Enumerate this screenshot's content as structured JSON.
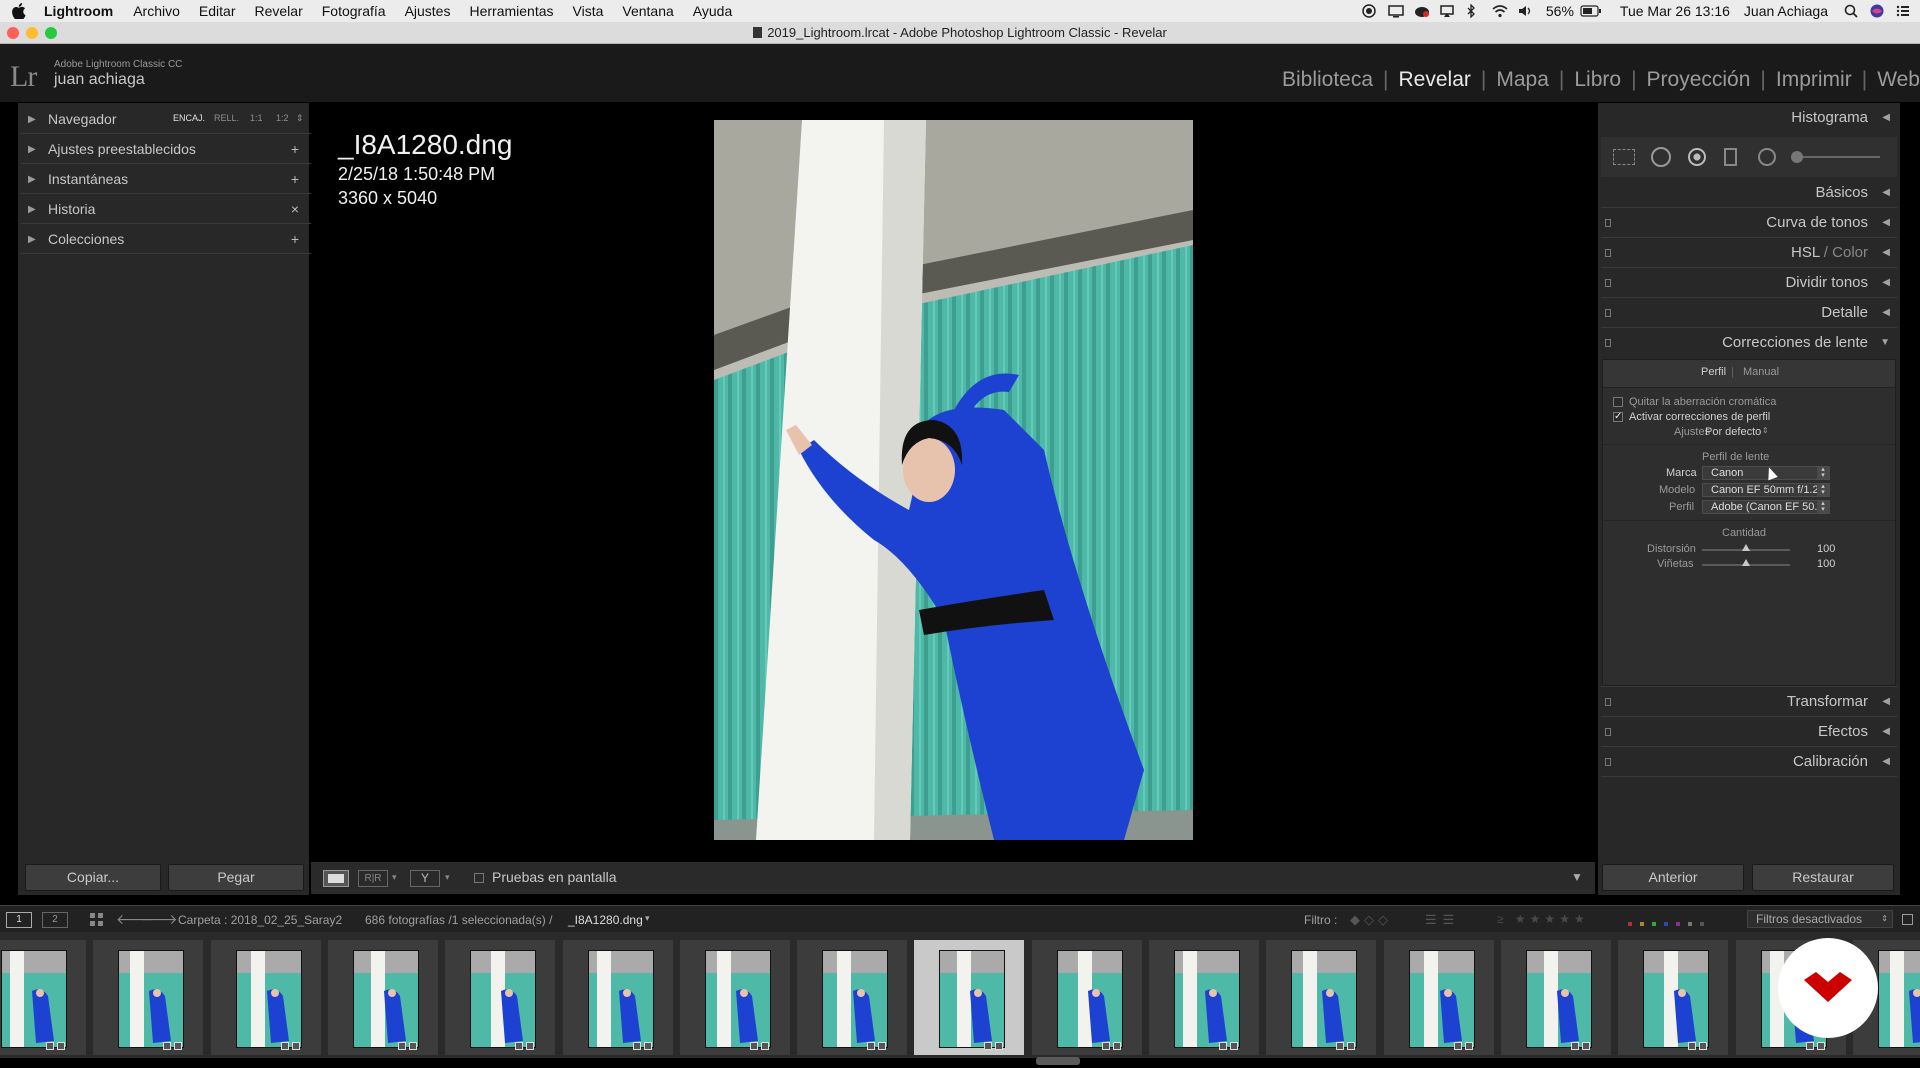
{
  "menubar": {
    "app": "Lightroom",
    "items": [
      "Archivo",
      "Editar",
      "Revelar",
      "Fotografía",
      "Ajustes",
      "Herramientas",
      "Vista",
      "Ventana",
      "Ayuda"
    ],
    "battery": "56%",
    "datetime": "Tue Mar 26  13:16",
    "user": "Juan Achiaga"
  },
  "window": {
    "title": "2019_Lightroom.lrcat - Adobe Photoshop Lightroom Classic - Revelar"
  },
  "identity": {
    "product": "Adobe Lightroom Classic CC",
    "user": "juan achiaga",
    "logo": "Lr"
  },
  "modules": {
    "items": [
      "Biblioteca",
      "Revelar",
      "Mapa",
      "Libro",
      "Proyección",
      "Imprimir",
      "Web"
    ],
    "active": "Revelar"
  },
  "left_panel": {
    "navigator": {
      "label": "Navegador",
      "zoom_options": [
        "ENCAJ.",
        "RELL.",
        "1:1",
        "1:2"
      ],
      "active_zoom": "ENCAJ."
    },
    "sections": [
      {
        "label": "Ajustes preestablecidos",
        "action": "+"
      },
      {
        "label": "Instantáneas",
        "action": "+"
      },
      {
        "label": "Historia",
        "action": "×"
      },
      {
        "label": "Colecciones",
        "action": "+"
      }
    ],
    "copy_label": "Copiar...",
    "paste_label": "Pegar"
  },
  "image_info": {
    "filename": "_I8A1280.dng",
    "datetime": "2/25/18 1:50:48 PM",
    "dimensions": "3360 x 5040"
  },
  "toolbar": {
    "soft_proof_label": "Pruebas en pantalla"
  },
  "right_panel": {
    "histogram": "Histograma",
    "sections": [
      "Básicos",
      "Curva de tonos",
      "Dividir tonos",
      "Detalle"
    ],
    "hsl": {
      "main": "HSL",
      "sep": " / ",
      "color": "Color"
    },
    "lens": {
      "title": "Correcciones de lente",
      "tabs": [
        "Perfil",
        "Manual"
      ],
      "active_tab": "Perfil",
      "remove_ca": {
        "label": "Quitar la aberración cromática",
        "checked": false
      },
      "enable_profile": {
        "label": "Activar correcciones de perfil",
        "checked": true
      },
      "setup_label": "Ajustes",
      "setup_value": "Por defecto",
      "profile_heading": "Perfil de lente",
      "make_label": "Marca",
      "make_value": "Canon",
      "model_label": "Modelo",
      "model_value": "Canon EF 50mm f/1.2...",
      "profile_label": "Perfil",
      "profile_value": "Adobe (Canon EF 50...",
      "amount_heading": "Cantidad",
      "distortion_label": "Distorsión",
      "distortion_value": "100",
      "vignetting_label": "Viñetas",
      "vignetting_value": "100"
    },
    "bottom_sections": [
      "Transformar",
      "Efectos",
      "Calibración"
    ],
    "previous_label": "Anterior",
    "reset_label": "Restaurar"
  },
  "filmstrip_bar": {
    "screen1": "1",
    "screen2": "2",
    "source": "Carpeta : 2018_02_25_Saray2",
    "count": "686 fotografías /1 seleccionada(s) /",
    "current_file": "_I8A1280.dng",
    "filter_label": "Filtro :",
    "filter_value": "Filtros desactivados"
  },
  "filmstrip": {
    "count": 17,
    "selected_index": 8
  },
  "colors": {
    "accent_brand": "#cc0000",
    "panel_bg": "#282828",
    "teal": "#4bb8a8",
    "dress_blue": "#1a3fc9"
  }
}
